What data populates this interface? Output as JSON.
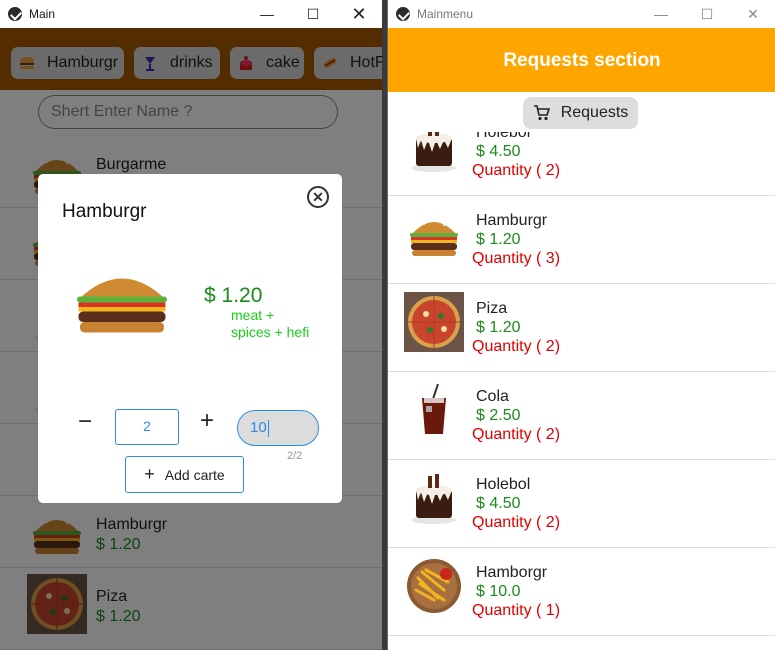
{
  "main_window": {
    "title": "Main",
    "categories": [
      {
        "label": "Hamburgr",
        "icon": "burger-icon"
      },
      {
        "label": "drinks",
        "icon": "drink-icon"
      },
      {
        "label": "cake",
        "icon": "cake-icon"
      },
      {
        "label": "HotF",
        "icon": "hotdog-icon"
      }
    ],
    "search": {
      "placeholder": "Shert Enter Name ?"
    },
    "products": [
      {
        "name": "Burgarme",
        "price": ""
      },
      {
        "name": "",
        "price": ""
      },
      {
        "name": "",
        "price": ""
      },
      {
        "name": "",
        "price": ""
      },
      {
        "name": "",
        "price": ""
      },
      {
        "name": "Hamburgr",
        "price": "$ 1.20"
      },
      {
        "name": "Piza",
        "price": "$ 1.20"
      }
    ],
    "dialog": {
      "title": "Hamburgr",
      "name": "Hamburgr",
      "price": "$ 1.20",
      "description": "meat + spices + hefi",
      "quantity": "2",
      "note_value": "10",
      "counter": "2/2",
      "add_label": "Add carte",
      "minus_label": "−",
      "plus_label": "+"
    }
  },
  "menu_window": {
    "title": "Mainmenu",
    "header": "Requests section",
    "requests_button": "Requests",
    "requests": [
      {
        "name": "Holebol",
        "price": "$ 4.50",
        "quantity": "Quantity ( 2)",
        "kind": "cake"
      },
      {
        "name": "Hamburgr",
        "price": "$ 1.20",
        "quantity": "Quantity ( 3)",
        "kind": "burger"
      },
      {
        "name": "Piza",
        "price": "$ 1.20",
        "quantity": "Quantity ( 2)",
        "kind": "pizza"
      },
      {
        "name": "Cola",
        "price": "$ 2.50",
        "quantity": "Quantity ( 2)",
        "kind": "cola"
      },
      {
        "name": "Holebol",
        "price": "$ 4.50",
        "quantity": "Quantity ( 2)",
        "kind": "cake"
      },
      {
        "name": "Hamborgr",
        "price": "$ 10.0",
        "quantity": "Quantity ( 1)",
        "kind": "fries"
      }
    ]
  },
  "colors": {
    "accent": "#ffa500",
    "price": "#1a8a1a",
    "quantity": "#e00000",
    "input": "#2a8ee0"
  }
}
